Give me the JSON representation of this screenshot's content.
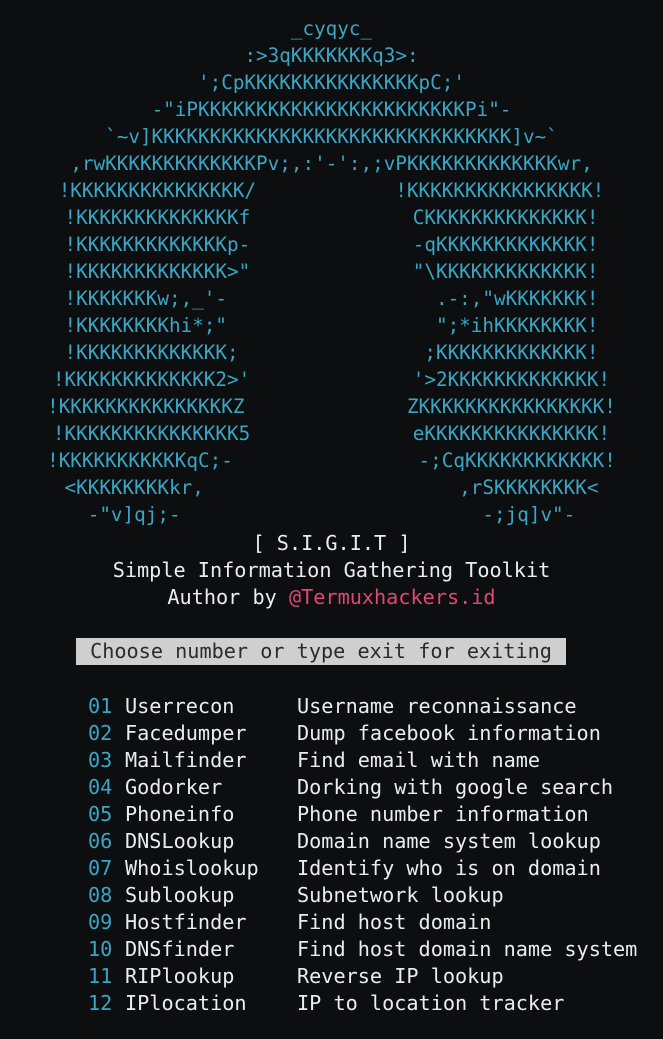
{
  "banner": {
    "art": [
      "_cyqyc_",
      ":>3qKKKKKKKq3>:",
      "';CpKKKKKKKKKKKKKKKpC;'",
      "-\"iPKKKKKKKKKKKKKKKKKKKKKKKPi\"-",
      "`~v]KKKKKKKKKKKKKKKKKKKKKKKKKKKKKKK]v~`",
      ",rwKKKKKKKKKKKKKPv;,:'-':,;vPKKKKKKKKKKKKKwr,",
      "!KKKKKKKKKKKKKKK/            !KKKKKKKKKKKKKKKK!",
      "!KKKKKKKKKKKKKKf              CKKKKKKKKKKKKKK!",
      "!KKKKKKKKKKKKKp-              -qKKKKKKKKKKKKK!",
      "!KKKKKKKKKKKKK>\"              \"\\KKKKKKKKKKKKK!",
      "!KKKKKKKw;,_'-                  .-:,\"wKKKKKKK!",
      "!KKKKKKKKhi*;\"                  \";*ihKKKKKKKK!",
      "!KKKKKKKKKKKKK;                ;KKKKKKKKKKKKK!",
      "!KKKKKKKKKKKKK2>'              '>2KKKKKKKKKKKKK!",
      "!KKKKKKKKKKKKKKKZ              ZKKKKKKKKKKKKKKKK!",
      "!KKKKKKKKKKKKKKK5              eKKKKKKKKKKKKKKK!",
      "!KKKKKKKKKKKqC;-                -;CqKKKKKKKKKKKK!",
      "<KKKKKKKKkr,                      ,rSKKKKKKKK<",
      "-\"v]qj;-                          -;jq]v\"-"
    ],
    "name": "[ S.I.G.I.T ]",
    "subtitle": "Simple Information Gathering Toolkit",
    "author_prefix": "Author by ",
    "author_handle": "@Termuxhackers.id"
  },
  "prompt": "Choose number or type exit for exiting",
  "menu": [
    {
      "num": "01",
      "name": "Userrecon",
      "desc": "Username reconnaissance"
    },
    {
      "num": "02",
      "name": "Facedumper",
      "desc": "Dump facebook information"
    },
    {
      "num": "03",
      "name": "Mailfinder",
      "desc": "Find email with name"
    },
    {
      "num": "04",
      "name": "Godorker",
      "desc": "Dorking with google search"
    },
    {
      "num": "05",
      "name": "Phoneinfo",
      "desc": "Phone number information"
    },
    {
      "num": "06",
      "name": "DNSLookup",
      "desc": "Domain name system lookup"
    },
    {
      "num": "07",
      "name": "Whoislookup",
      "desc": "Identify who is on domain"
    },
    {
      "num": "08",
      "name": "Sublookup",
      "desc": "Subnetwork lookup"
    },
    {
      "num": "09",
      "name": "Hostfinder",
      "desc": "Find host domain"
    },
    {
      "num": "10",
      "name": "DNSfinder",
      "desc": "Find host domain name system"
    },
    {
      "num": "11",
      "name": "RIPlookup",
      "desc": "Reverse IP lookup"
    },
    {
      "num": "12",
      "name": "IPlocation",
      "desc": "IP to location tracker"
    }
  ],
  "colors": {
    "accent": "#3aa6c4",
    "handle": "#e0457b",
    "background": "#0d0e10"
  }
}
